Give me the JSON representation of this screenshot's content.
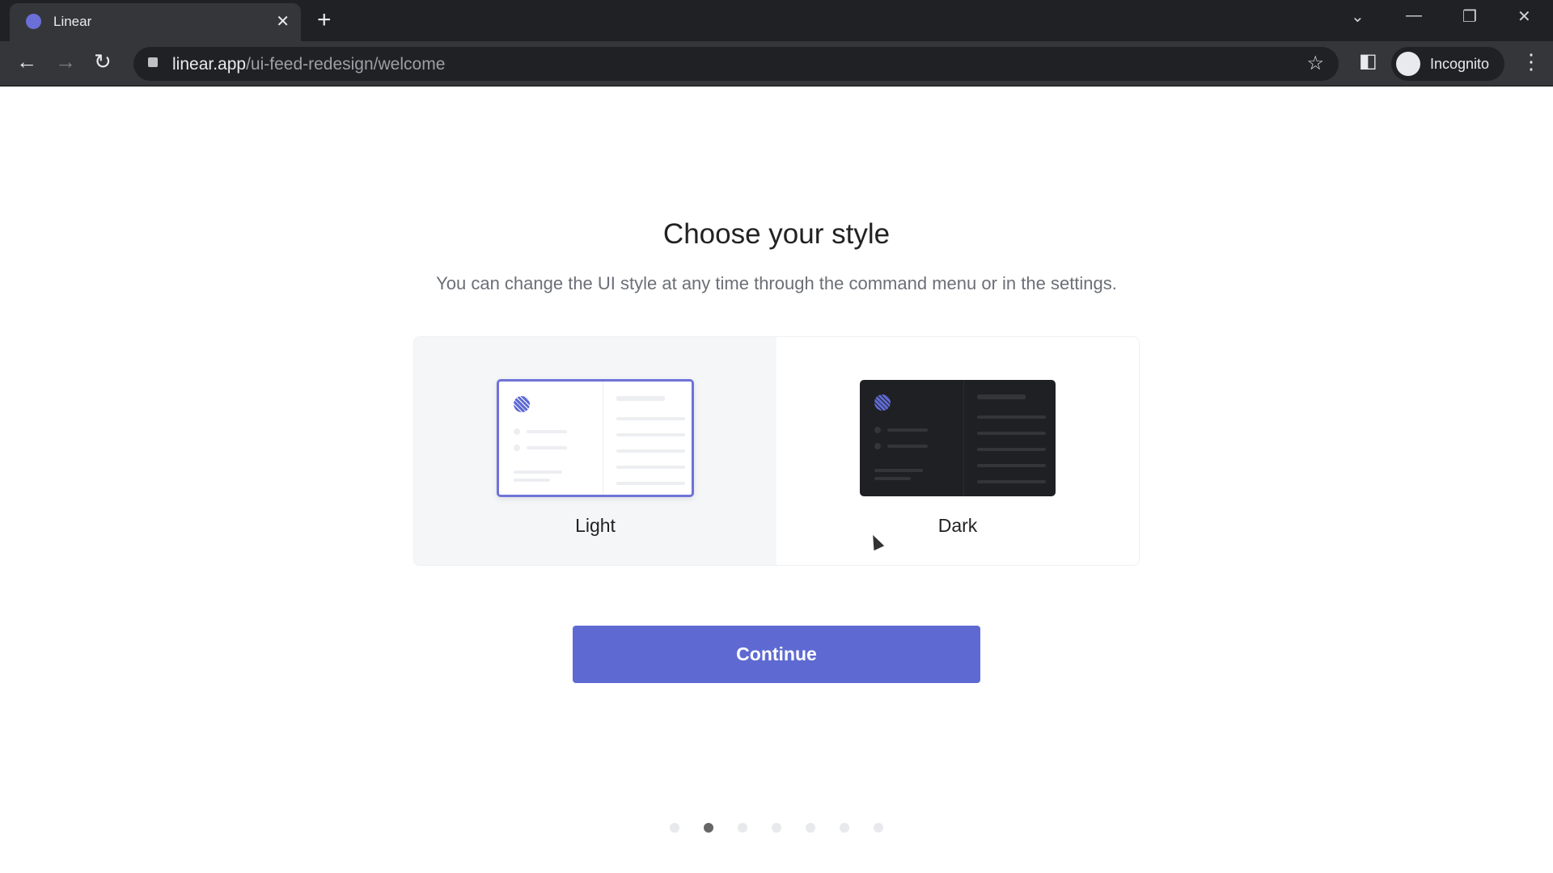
{
  "browser": {
    "tab_title": "Linear",
    "url_domain": "linear.app",
    "url_path": "/ui-feed-redesign/welcome",
    "profile": "Incognito"
  },
  "page": {
    "title": "Choose your style",
    "subtitle": "You can change the UI style at any time through the command menu or in the settings.",
    "options": [
      {
        "label": "Light",
        "selected": true
      },
      {
        "label": "Dark",
        "selected": false
      }
    ],
    "continue_label": "Continue",
    "steps": {
      "total": 7,
      "current": 2
    }
  },
  "colors": {
    "accent": "#5e6ad2",
    "dark_preview": "#1f2023"
  }
}
